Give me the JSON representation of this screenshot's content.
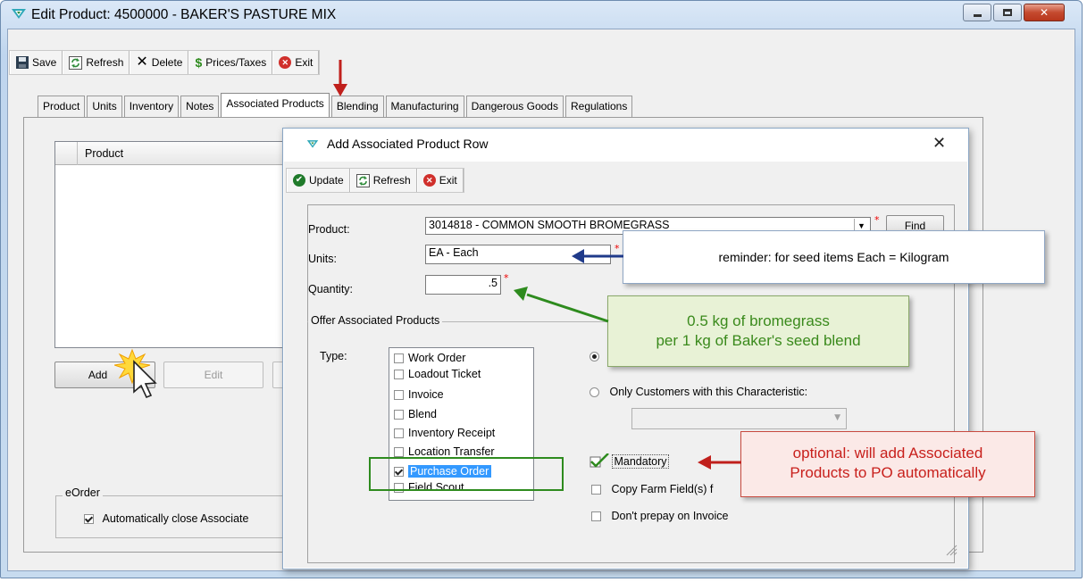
{
  "window": {
    "title": "Edit Product: 4500000 - BAKER'S PASTURE MIX",
    "controls": [
      "minimize",
      "maximize",
      "close"
    ]
  },
  "toolbar": {
    "save": "Save",
    "refresh": "Refresh",
    "delete": "Delete",
    "prices_taxes": "Prices/Taxes",
    "exit": "Exit"
  },
  "tabs": [
    "Product",
    "Units",
    "Inventory",
    "Notes",
    "Associated Products",
    "Blending",
    "Manufacturing",
    "Dangerous Goods",
    "Regulations"
  ],
  "active_tab": "Associated Products",
  "grid": {
    "column_header": "Product"
  },
  "buttons": {
    "add": "Add",
    "edit": "Edit"
  },
  "eorder": {
    "title": "eOrder",
    "auto_close_label": "Automatically close Associate"
  },
  "dialog": {
    "title": "Add Associated Product Row",
    "toolbar": {
      "update": "Update",
      "refresh": "Refresh",
      "exit": "Exit"
    },
    "product_label": "Product:",
    "product_value": "3014818 - COMMON SMOOTH BROMEGRASS",
    "find_button": "Find",
    "units_label": "Units:",
    "units_value": "EA - Each",
    "quantity_label": "Quantity:",
    "quantity_value": ".5",
    "offer_group_title": "Offer Associated Products",
    "type_label": "Type:",
    "type_items": [
      {
        "label": "Work Order",
        "checked": false,
        "selected": false
      },
      {
        "label": "Loadout Ticket",
        "checked": false,
        "selected": false
      },
      {
        "label": "Invoice",
        "checked": false,
        "selected": false
      },
      {
        "label": "Blend",
        "checked": false,
        "selected": false
      },
      {
        "label": "Inventory Receipt",
        "checked": false,
        "selected": false
      },
      {
        "label": "Location Transfer",
        "checked": false,
        "selected": false
      },
      {
        "label": "Purchase Order",
        "checked": true,
        "selected": true
      },
      {
        "label": "Field Scout",
        "checked": false,
        "selected": false
      }
    ],
    "only_customers_label": "Only Customers with this Characteristic:",
    "mandatory_label": "Mandatory",
    "copy_farm_label": "Copy Farm Field(s) f",
    "dont_prepay_label": "Don't prepay on Invoice"
  },
  "callouts": {
    "units_note": "reminder: for seed items Each = Kilogram",
    "quantity_note_line1": "0.5 kg of bromegrass",
    "quantity_note_line2": "per 1 kg of Baker's seed blend",
    "mandatory_note_line1": "optional: will add Associated",
    "mandatory_note_line2": "Products to PO automatically"
  },
  "colors": {
    "arrow_red": "#c0201c",
    "arrow_blue": "#1f3a8a",
    "arrow_green": "#2e8b1e",
    "highlight_green": "#2e8b1e",
    "selection_blue": "#3399ff"
  }
}
